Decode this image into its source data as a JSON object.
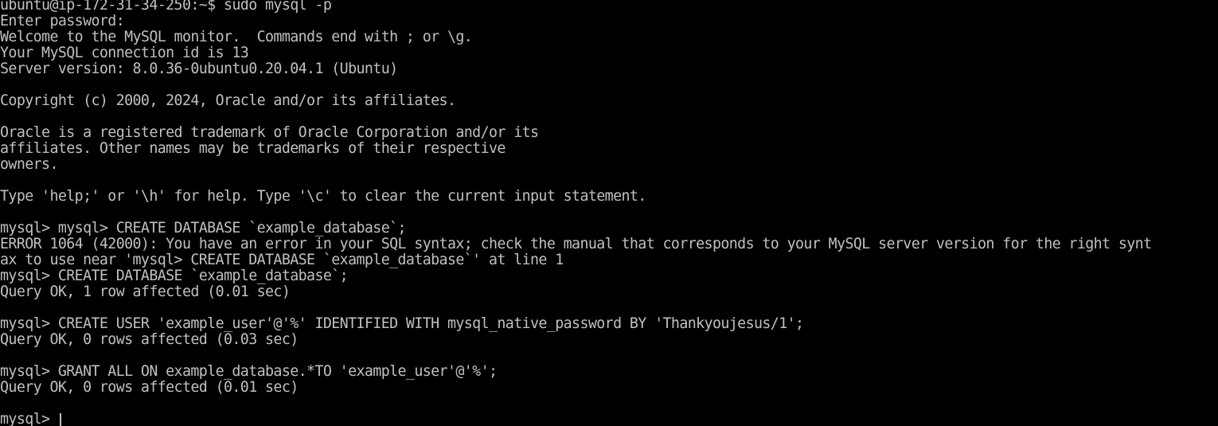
{
  "terminal": {
    "lines": [
      "ubuntu@ip-172-31-34-250:~$ sudo mysql -p",
      "Enter password:",
      "Welcome to the MySQL monitor.  Commands end with ; or \\g.",
      "Your MySQL connection id is 13",
      "Server version: 8.0.36-0ubuntu0.20.04.1 (Ubuntu)",
      "",
      "Copyright (c) 2000, 2024, Oracle and/or its affiliates.",
      "",
      "Oracle is a registered trademark of Oracle Corporation and/or its",
      "affiliates. Other names may be trademarks of their respective",
      "owners.",
      "",
      "Type 'help;' or '\\h' for help. Type '\\c' to clear the current input statement.",
      "",
      "mysql> mysql> CREATE DATABASE `example_database`;",
      "ERROR 1064 (42000): You have an error in your SQL syntax; check the manual that corresponds to your MySQL server version for the right synt",
      "ax to use near 'mysql> CREATE DATABASE `example_database`' at line 1",
      "mysql> CREATE DATABASE `example_database`;",
      "Query OK, 1 row affected (0.01 sec)",
      "",
      "mysql> CREATE USER 'example_user'@'%' IDENTIFIED WITH mysql_native_password BY 'Thankyoujesus/1';",
      "Query OK, 0 rows affected (0.03 sec)",
      "",
      "mysql> GRANT ALL ON example_database.*TO 'example_user'@'%';",
      "Query OK, 0 rows affected (0.01 sec)",
      ""
    ],
    "prompt": "mysql> ",
    "colors": {
      "background": "#000000",
      "foreground": "#c0c0c0"
    }
  }
}
